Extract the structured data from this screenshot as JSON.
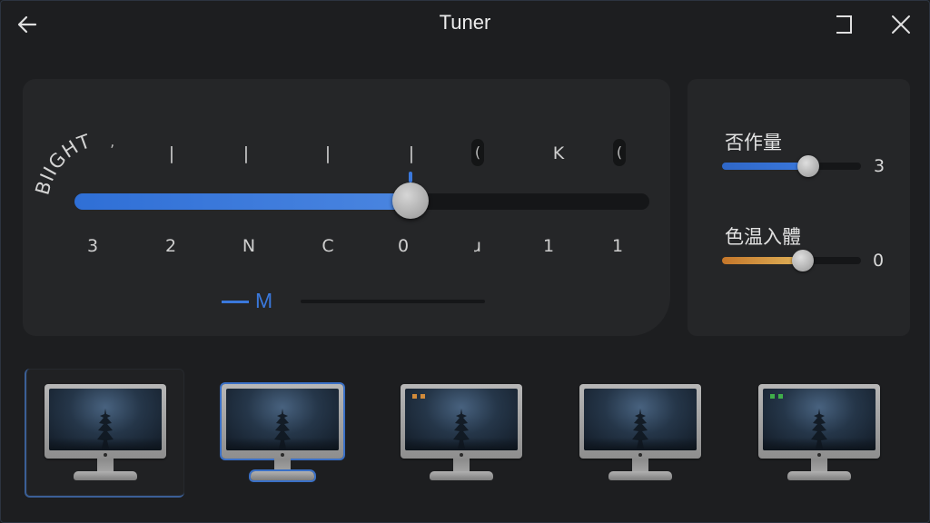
{
  "window": {
    "title": "Tuner"
  },
  "main": {
    "arc_label": "BIIGHT",
    "arc_tail": "ʼ",
    "ticks": [
      "|",
      "|",
      "|",
      "|",
      "(",
      "K",
      "("
    ],
    "numbers": [
      "3",
      "2",
      "N",
      "C",
      "0",
      "ɹ",
      "1",
      "1"
    ],
    "slider": {
      "fraction": 0.585,
      "accent": "#3a78dc"
    },
    "mode_label": "M"
  },
  "side": {
    "sliders": [
      {
        "label": "否作量",
        "value": "3",
        "fraction": 0.62,
        "fill": "#3a78dc"
      },
      {
        "label": "色温入體",
        "value": "0",
        "fraction": 0.58,
        "fill": "#d08a3a"
      }
    ]
  },
  "presets": [
    {
      "name": "preset-1",
      "badge": ""
    },
    {
      "name": "preset-2",
      "badge": ""
    },
    {
      "name": "preset-3",
      "badge": "orange"
    },
    {
      "name": "preset-4",
      "badge": ""
    },
    {
      "name": "preset-5",
      "badge": "green"
    }
  ],
  "icons": {
    "back": "back-arrow-icon",
    "maximize": "maximize-icon",
    "close": "close-icon"
  },
  "colors": {
    "accent": "#3a78dc",
    "warm": "#d08a3a",
    "green": "#3fae4a"
  }
}
